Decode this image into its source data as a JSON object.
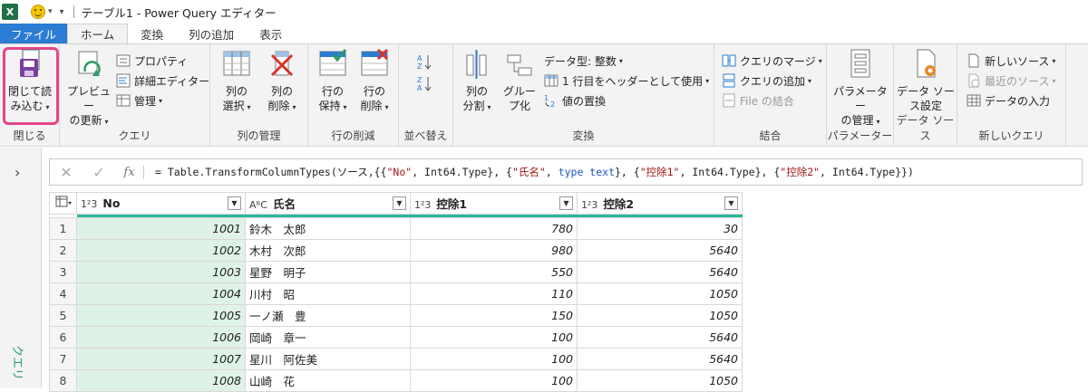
{
  "window": {
    "app_logo": "X",
    "title": "テーブル1 - Power Query エディター"
  },
  "tabs": [
    {
      "label": "ファイル"
    },
    {
      "label": "ホーム"
    },
    {
      "label": "変換"
    },
    {
      "label": "列の追加"
    },
    {
      "label": "表示"
    }
  ],
  "ribbon": {
    "close": {
      "line1": "閉じて読",
      "line2": "み込む",
      "group": "閉じる"
    },
    "query": {
      "preview_line1": "プレビュー",
      "preview_line2": "の更新",
      "properties": "プロパティ",
      "advanced_editor": "詳細エディター",
      "manage": "管理",
      "group": "クエリ"
    },
    "manage_columns": {
      "select_line1": "列の",
      "select_line2": "選択",
      "remove_line1": "列の",
      "remove_line2": "削除",
      "group": "列の管理"
    },
    "reduce_rows": {
      "keep_line1": "行の",
      "keep_line2": "保持",
      "remove_line1": "行の",
      "remove_line2": "削除",
      "group": "行の削減"
    },
    "sort": {
      "group": "並べ替え"
    },
    "transform": {
      "split_line1": "列の",
      "split_line2": "分割",
      "group_line1": "グルー",
      "group_line2": "プ化",
      "data_type": "データ型: 整数",
      "first_row_header": "1 行目をヘッダーとして使用",
      "replace_values": "値の置換",
      "group": "変換"
    },
    "combine": {
      "merge_queries": "クエリのマージ",
      "append_queries": "クエリの追加",
      "combine_files": "File の結合",
      "group": "結合"
    },
    "parameters": {
      "line1": "パラメーター",
      "line2": "の管理",
      "group": "パラメーター"
    },
    "data_source": {
      "line1": "データ ソー",
      "line2": "ス設定",
      "group": "データ ソース"
    },
    "new_query": {
      "new_source": "新しいソース",
      "recent_sources": "最近のソース",
      "enter_data": "データの入力",
      "group": "新しいクエリ"
    }
  },
  "formula_bar": {
    "fx": "fx",
    "p1": "= Table.TransformColumnTypes(ソース,{{",
    "s1": "\"No\"",
    "p2": ", Int64.Type}, {",
    "s2": "\"氏名\"",
    "p3": ", ",
    "k1": "type text",
    "p4": "}, {",
    "s3": "\"控除1\"",
    "p5": ", Int64.Type}, {",
    "s4": "\"控除2\"",
    "p6": ", Int64.Type}})"
  },
  "side_pane": {
    "label": "クエリ"
  },
  "table": {
    "columns": [
      {
        "type": "1²3",
        "name": "No"
      },
      {
        "type": "AᴮC",
        "name": "氏名"
      },
      {
        "type": "1²3",
        "name": "控除1"
      },
      {
        "type": "1²3",
        "name": "控除2"
      }
    ],
    "rows": [
      {
        "n": "1",
        "no": "1001",
        "name": "鈴木　太郎",
        "d1": "780",
        "d2": "30"
      },
      {
        "n": "2",
        "no": "1002",
        "name": "木村　次郎",
        "d1": "980",
        "d2": "5640"
      },
      {
        "n": "3",
        "no": "1003",
        "name": "星野　明子",
        "d1": "550",
        "d2": "5640"
      },
      {
        "n": "4",
        "no": "1004",
        "name": "川村　昭",
        "d1": "110",
        "d2": "1050"
      },
      {
        "n": "5",
        "no": "1005",
        "name": "一ノ瀬　豊",
        "d1": "150",
        "d2": "1050"
      },
      {
        "n": "6",
        "no": "1006",
        "name": "岡崎　章一",
        "d1": "100",
        "d2": "5640"
      },
      {
        "n": "7",
        "no": "1007",
        "name": "星川　阿佐美",
        "d1": "100",
        "d2": "5640"
      },
      {
        "n": "8",
        "no": "1008",
        "name": "山崎　花",
        "d1": "100",
        "d2": "1050"
      }
    ]
  },
  "colors": {
    "accent": "#2b7cd3",
    "quality_bar": "#2ab89a",
    "highlight": "#e2468a"
  }
}
